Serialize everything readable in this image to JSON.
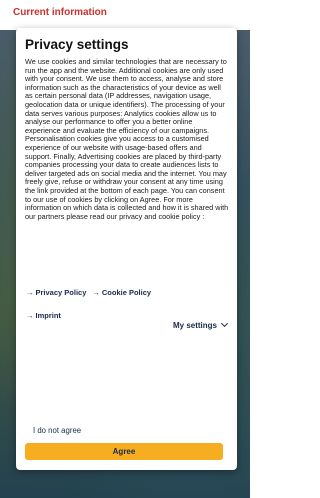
{
  "topbar": {
    "title": "Current information"
  },
  "modal": {
    "title": "Privacy settings",
    "body": "We use cookies and similar technologies that are necessary to run the app and the website. Additional cookies are only used with your consent. We use them to access, analyse and store information such as the characteristics of your device as well as certain personal data (IP addresses, navigation usage, geolocation data or unique identifiers). The processing of your data serves various purposes: Analytics cookies allow us to analyse our performance to offer you a better online experience and evaluate the efficiency of our campaigns. Personalisation cookies give you access to a customised experience of our website with usage-based offers and support. Finally, Advertising cookies are placed by third-party companies processing your data to create audiences lists to deliver targeted ads on social media and the internet. You may freely give, refuse or withdraw your consent at any time using the link provided at the bottom of each page. You can consent to our use of cookies by clicking on Agree. For more information on which data is collected and how it is shared with our partners please read our privacy and cookie policy :",
    "links": {
      "privacy_policy": "Privacy Policy",
      "cookie_policy": "Cookie Policy",
      "imprint": "Imprint"
    },
    "my_settings": "My settings",
    "not_agree": "I do not agree",
    "agree": "Agree"
  },
  "colors": {
    "accent": "#f6ad1f",
    "link": "#1b2a4a",
    "topbar_title": "#c9322f"
  }
}
